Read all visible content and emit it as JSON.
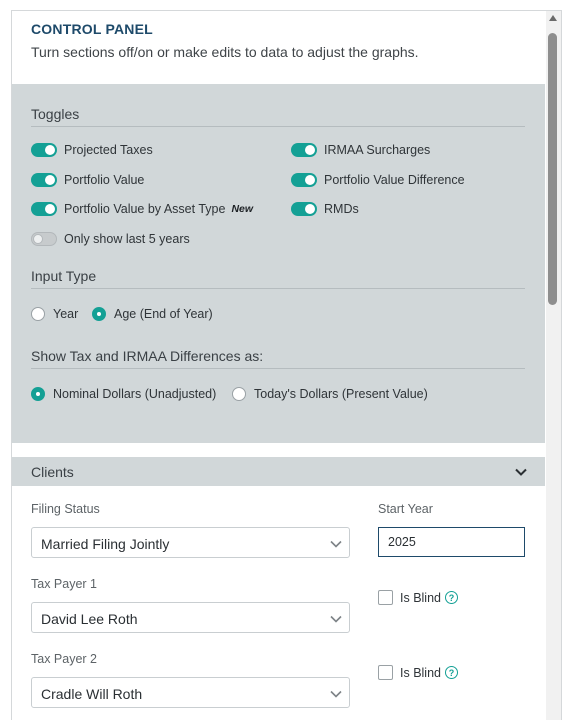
{
  "header": {
    "title": "CONTROL PANEL",
    "subtitle": "Turn sections off/on or make edits to data to adjust the graphs."
  },
  "toggles": {
    "section_label": "Toggles",
    "items": [
      {
        "label": "Projected Taxes",
        "on": true
      },
      {
        "label": "IRMAA Surcharges",
        "on": true
      },
      {
        "label": "Portfolio Value",
        "on": true
      },
      {
        "label": "Portfolio Value Difference",
        "on": true
      },
      {
        "label": "Portfolio Value by Asset Type",
        "on": true,
        "badge": "New"
      },
      {
        "label": "RMDs",
        "on": true
      },
      {
        "label": "Only show last 5 years",
        "on": false
      }
    ]
  },
  "input_type": {
    "section_label": "Input Type",
    "options": [
      {
        "label": "Year",
        "selected": false
      },
      {
        "label": "Age (End of Year)",
        "selected": true
      }
    ]
  },
  "differences": {
    "section_label": "Show Tax and IRMAA Differences as:",
    "options": [
      {
        "label": "Nominal Dollars (Unadjusted)",
        "selected": true
      },
      {
        "label": "Today's Dollars (Present Value)",
        "selected": false
      }
    ]
  },
  "clients": {
    "section_label": "Clients",
    "filing_status_label": "Filing Status",
    "filing_status_value": "Married Filing Jointly",
    "start_year_label": "Start Year",
    "start_year_value": "2025",
    "taxpayer1_label": "Tax Payer 1",
    "taxpayer1_value": "David Lee Roth",
    "taxpayer2_label": "Tax Payer 2",
    "taxpayer2_value": "Cradle Will Roth",
    "is_blind_label": "Is Blind",
    "help_glyph": "?"
  },
  "colors": {
    "accent": "#14a095",
    "title": "#1e4a6a",
    "section_bg": "#d1d7d9"
  }
}
